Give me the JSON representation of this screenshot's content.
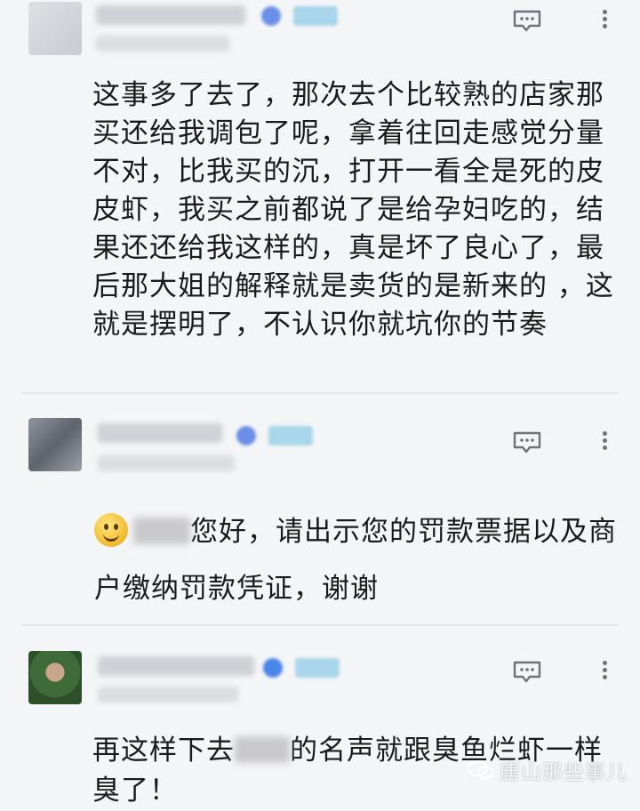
{
  "comments": [
    {
      "author": "",
      "time": "",
      "text": "这事多了去了，那次去个比较熟的店家那买还给我调包了呢，拿着往回走感觉分量不对，比我买的沉，打开一看全是死的皮皮虾，我买之前都说了是给孕妇吃的，结果还还给我这样的，真是坏了良心了，最后那大姐的解释就是卖货的是新来的 ，这就是摆明了，不认识你就坑你的节奏"
    },
    {
      "author": "",
      "time": "",
      "text": "您好，请出示您的罚款票据以及商户缴纳罚款凭证，谢谢",
      "emoji": "smiley-icon"
    },
    {
      "author": "",
      "time": "",
      "text_before": "再这样下去",
      "text_after": "的名声就跟臭鱼烂虾一样臭了！"
    }
  ],
  "icons": {
    "reply": "comment-bubble-icon",
    "more": "more-vertical-icon"
  },
  "watermark": "唐山那些事儿",
  "colors": {
    "background": "#f4f5f7",
    "text": "#1a1a1a",
    "icon": "#6e7178"
  }
}
